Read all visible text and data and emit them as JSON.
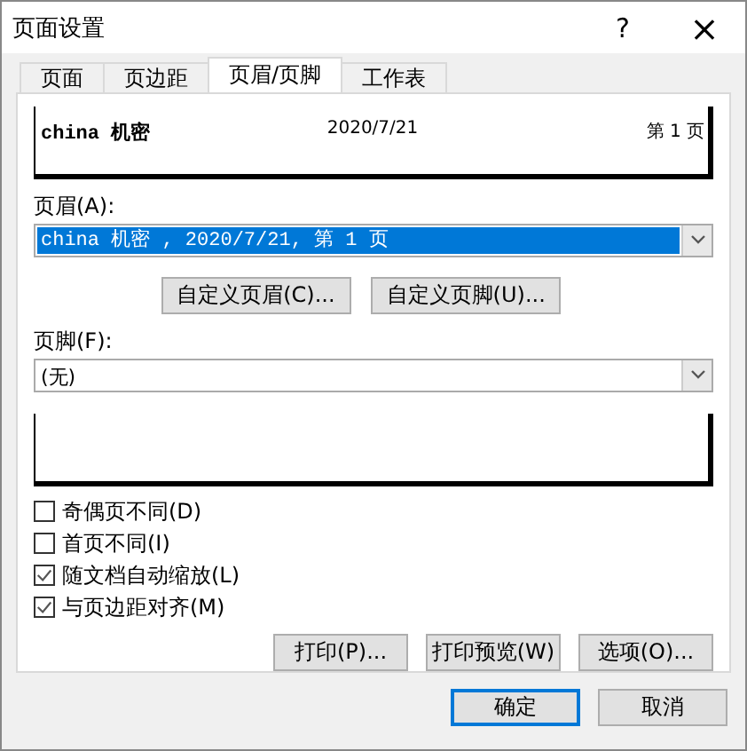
{
  "window": {
    "title": "页面设置",
    "help": "?",
    "close": "×"
  },
  "tabs": [
    {
      "label": "页面",
      "selected": false
    },
    {
      "label": "页边距",
      "selected": false
    },
    {
      "label": "页眉/页脚",
      "selected": true
    },
    {
      "label": "工作表",
      "selected": false
    }
  ],
  "header_preview": {
    "left": "china 机密",
    "center": "2020/7/21",
    "right": "第 1 页"
  },
  "header": {
    "label": "页眉(A):",
    "value": "china 机密 , 2020/7/21, 第 1 页",
    "highlighted": true
  },
  "custom_buttons": [
    "自定义页眉(C)...",
    "自定义页脚(U)..."
  ],
  "footer": {
    "label": "页脚(F):",
    "value": "(无)",
    "highlighted": false
  },
  "options": [
    {
      "label": "奇偶页不同(D)",
      "checked": false
    },
    {
      "label": "首页不同(I)",
      "checked": false
    },
    {
      "label": "随文档自动缩放(L)",
      "checked": true
    },
    {
      "label": "与页边距对齐(M)",
      "checked": true
    }
  ],
  "panel_buttons": [
    "打印(P)...",
    "打印预览(W)",
    "选项(O)..."
  ],
  "dialog_buttons": [
    {
      "label": "确定",
      "default": true
    },
    {
      "label": "取消",
      "default": false
    }
  ]
}
